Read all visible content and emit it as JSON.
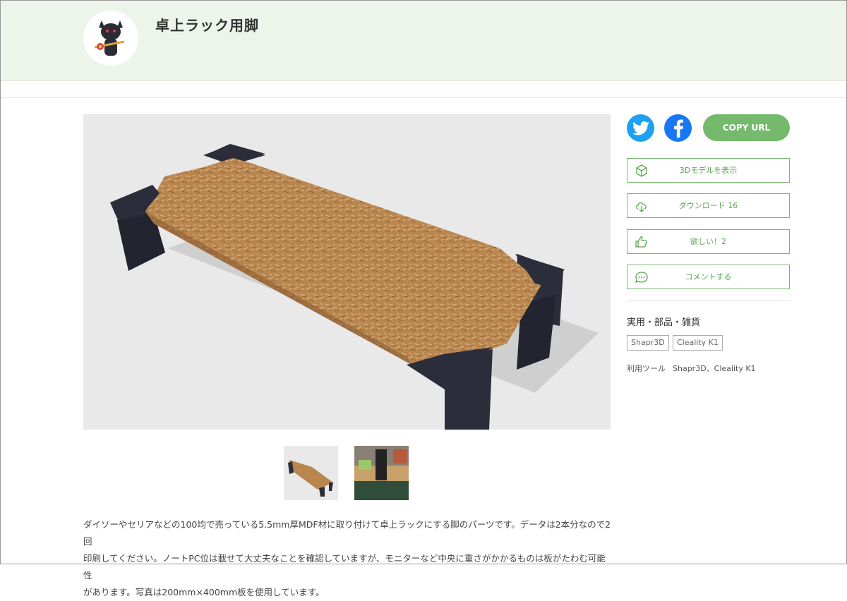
{
  "header": {
    "title": "卓上ラック用脚"
  },
  "share": {
    "twitter_icon": "twitter-bird-icon",
    "facebook_icon": "facebook-f-icon",
    "copy_url": "COPY URL"
  },
  "actions": {
    "view3d": "3Dモデルを表示",
    "download": "ダウンロード 16",
    "want": "欲しい！2",
    "comment": "コメントする"
  },
  "meta": {
    "category": "実用・部品・雑貨",
    "tags": [
      "Shapr3D",
      "Cleality K1"
    ],
    "tools_label": "利用ツール",
    "tools_value": "Shapr3D、Cleality K1"
  },
  "description": [
    "ダイソーやセリアなどの100均で売っている5.5mm厚MDF材に取り付けて卓上ラックにする脚のパーツです。データは2本分なので2回",
    "印刷してください。ノートPC位は載せて大丈夫なことを確認していますが、モニターなど中央に重さがかかるものは板がたわむ可能性",
    "があります。写真は200mm×400mm板を使用しています。"
  ],
  "colors": {
    "accent": "#75b96c",
    "header_bg": "#edf5ea",
    "twitter": "#1da1f2",
    "facebook": "#1877f2",
    "leg": "#2b2d3a",
    "board": "#b98650"
  }
}
